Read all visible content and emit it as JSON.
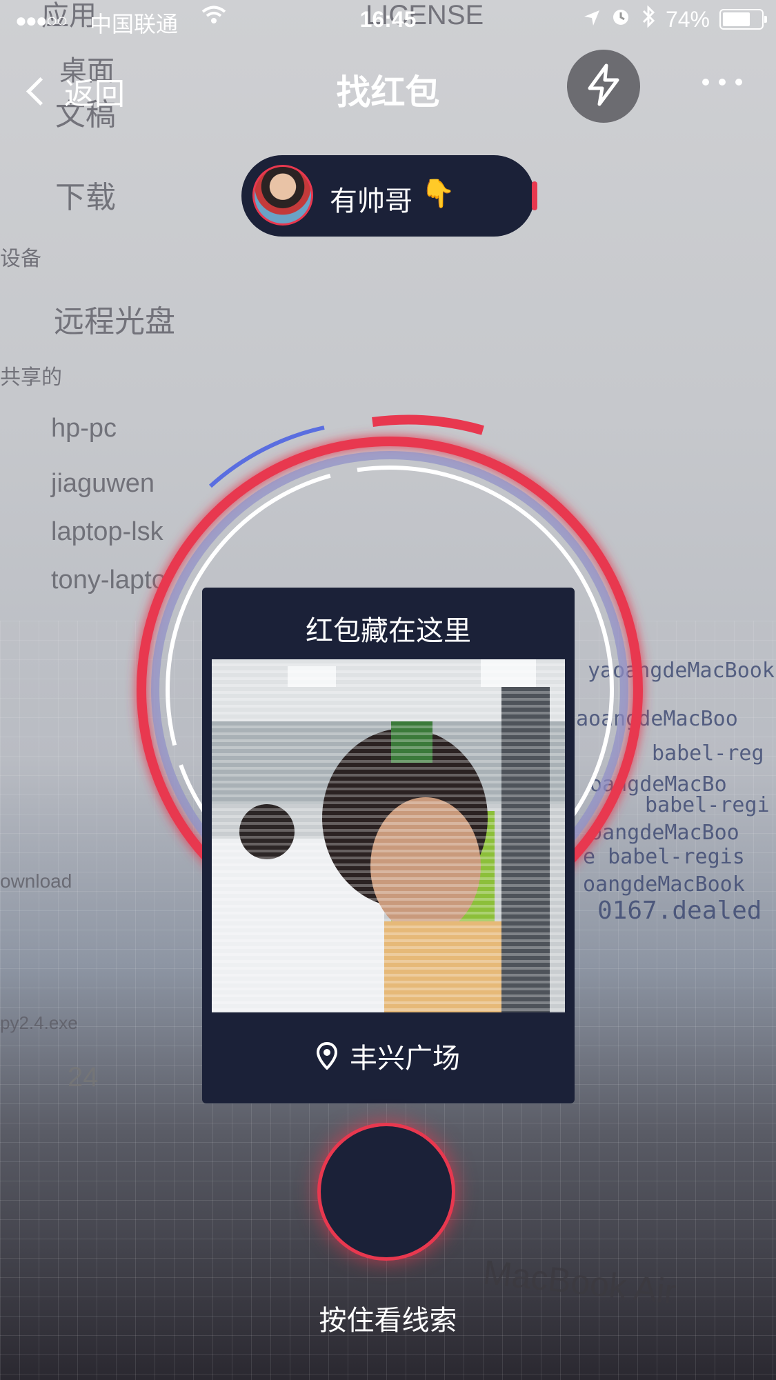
{
  "status_bar": {
    "signal": "●●●○○",
    "carrier": "中国联通",
    "time": "16:45",
    "battery": "74%",
    "battery_level": 0.74
  },
  "nav": {
    "back_label": "返回",
    "title": "找红包"
  },
  "user": {
    "name": "有帅哥",
    "emoji": "👇"
  },
  "card": {
    "heading": "红包藏在这里",
    "location": "丰兴广场"
  },
  "hold_label": "按住看线索",
  "background": {
    "sidebar": [
      "应用",
      "桌面",
      "文稿",
      "下载",
      "设备",
      "远程光盘",
      "共享的",
      "hp-pc",
      "jiaguwen",
      "laptop-lsk",
      "tony-lapto"
    ],
    "misc": [
      "LICENSE",
      "ownload",
      "py2.4.exe",
      "24",
      "MacBook Air"
    ],
    "terminal": [
      "yaoangdeMacBook",
      "aoangdeMacBoo",
      "babel-reg",
      "oangdeMacBo",
      "babel-regi",
      "oangdeMacBoo",
      "e babel-regis",
      "oangdeMacBook",
      "0167.dealed"
    ]
  },
  "colors": {
    "accent": "#e8384f",
    "card_bg": "#1b2138"
  }
}
